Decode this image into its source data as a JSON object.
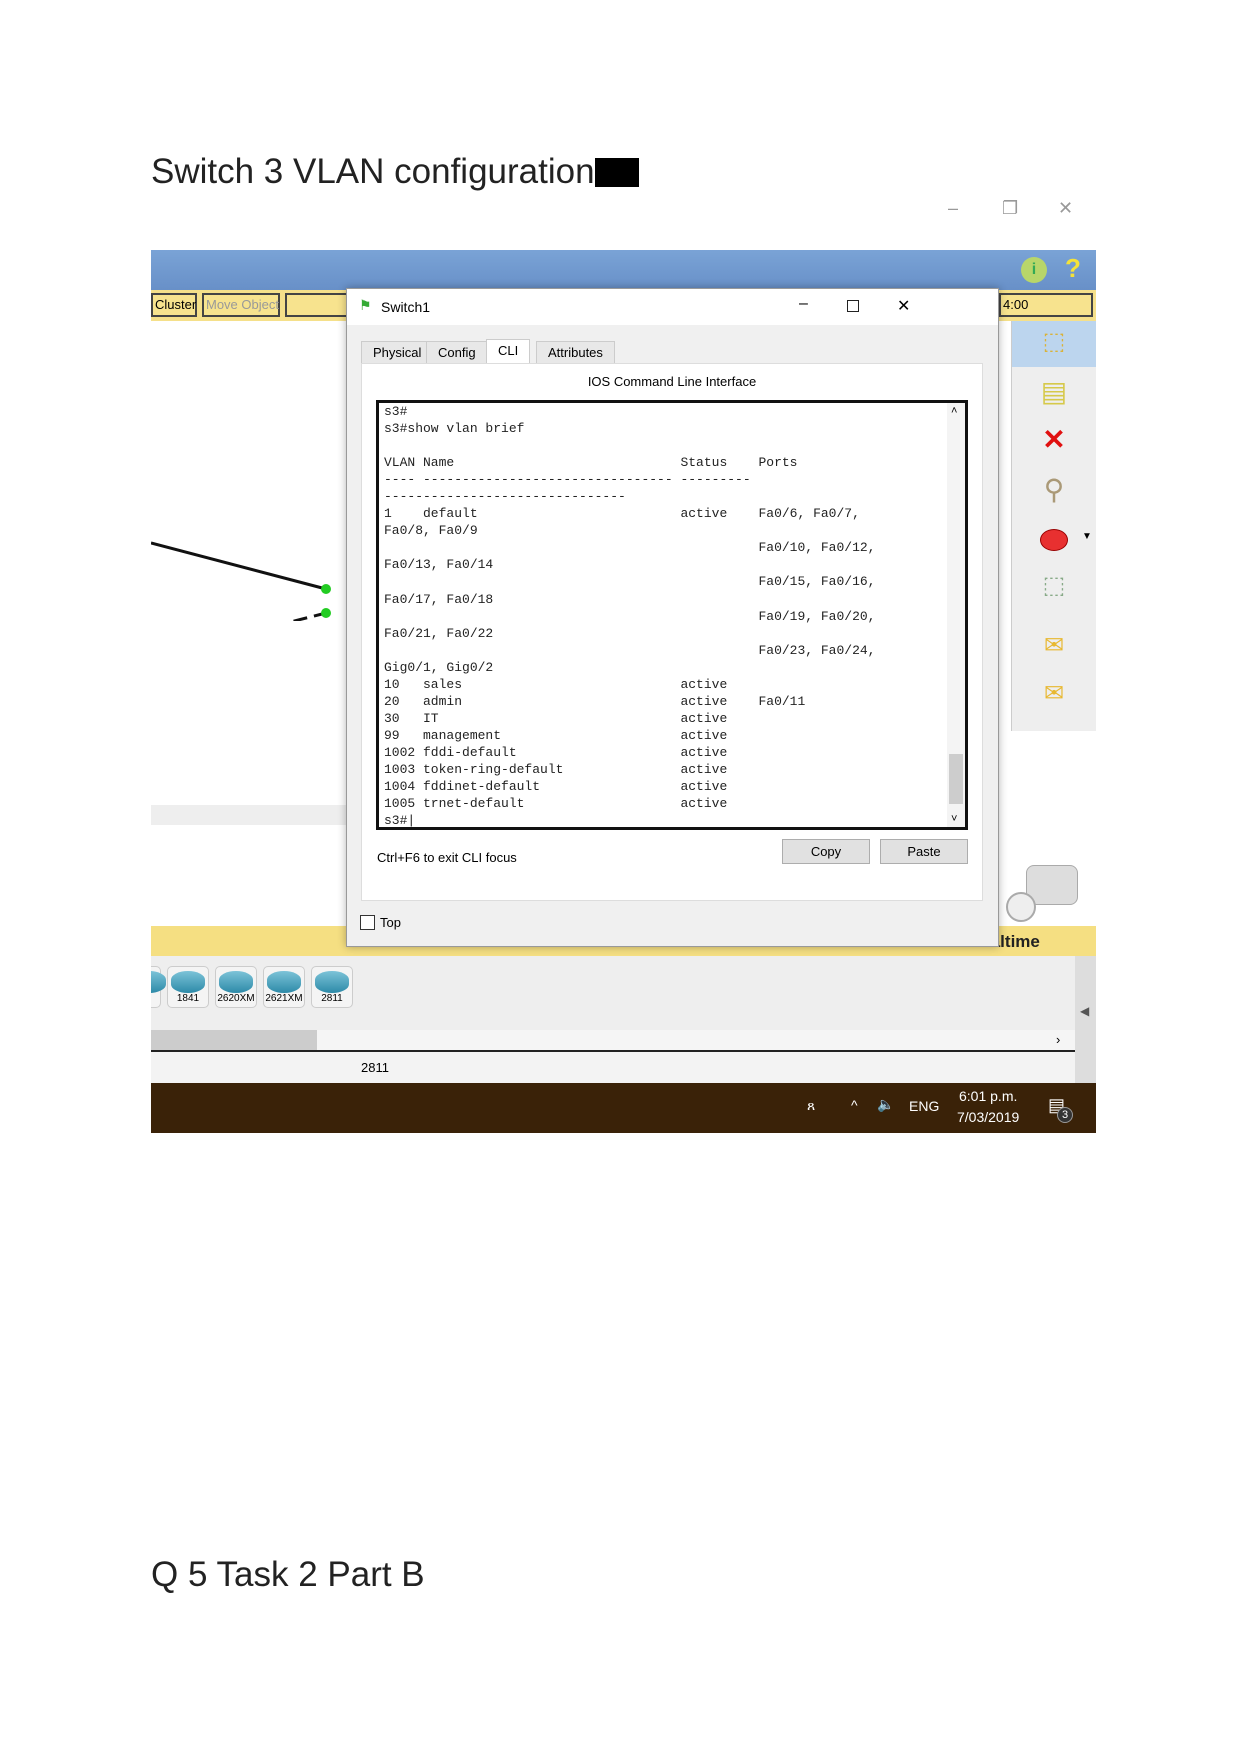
{
  "doc": {
    "heading1": "Switch 3 VLAN configuration",
    "heading2": "Q 5 Task 2 Part B"
  },
  "window_controls": {
    "minimize": "–",
    "restore": "❐",
    "close": "✕"
  },
  "pt": {
    "toolbar": {
      "cluster": "Cluster",
      "move_object": "Move Object",
      "time": "4:00"
    },
    "info_icon": "i",
    "help_icon": "?",
    "dialog": {
      "title": "Switch1",
      "tabs": [
        "Physical",
        "Config",
        "CLI",
        "Attributes"
      ],
      "active_tab": "CLI",
      "cli_header": "IOS Command Line Interface",
      "cli_lines": [
        "s3#",
        "s3#show vlan brief",
        "",
        "VLAN Name                             Status    Ports",
        "---- -------------------------------- ---------",
        "-------------------------------",
        "1    default                          active    Fa0/6, Fa0/7,",
        "Fa0/8, Fa0/9",
        "                                                Fa0/10, Fa0/12,",
        "Fa0/13, Fa0/14",
        "                                                Fa0/15, Fa0/16,",
        "Fa0/17, Fa0/18",
        "                                                Fa0/19, Fa0/20,",
        "Fa0/21, Fa0/22",
        "                                                Fa0/23, Fa0/24,",
        "Gig0/1, Gig0/2",
        "10   sales                            active",
        "20   admin                            active    Fa0/11",
        "30   IT                               active",
        "99   management                       active",
        "1002 fddi-default                     active",
        "1003 token-ring-default               active",
        "1004 fddinet-default                  active",
        "1005 trnet-default                    active",
        "s3#"
      ],
      "hint": "Ctrl+F6 to exit CLI focus",
      "copy": "Copy",
      "paste": "Paste",
      "top_label": "Top",
      "top_checked": false
    },
    "realtime": "Realtime",
    "devices": [
      "1841",
      "2620XM",
      "2621XM",
      "2811"
    ],
    "status_text": "2811",
    "taskbar": {
      "lang": "ENG",
      "time": "6:01 p.m.",
      "date": "7/03/2019",
      "notifications": "3"
    }
  }
}
